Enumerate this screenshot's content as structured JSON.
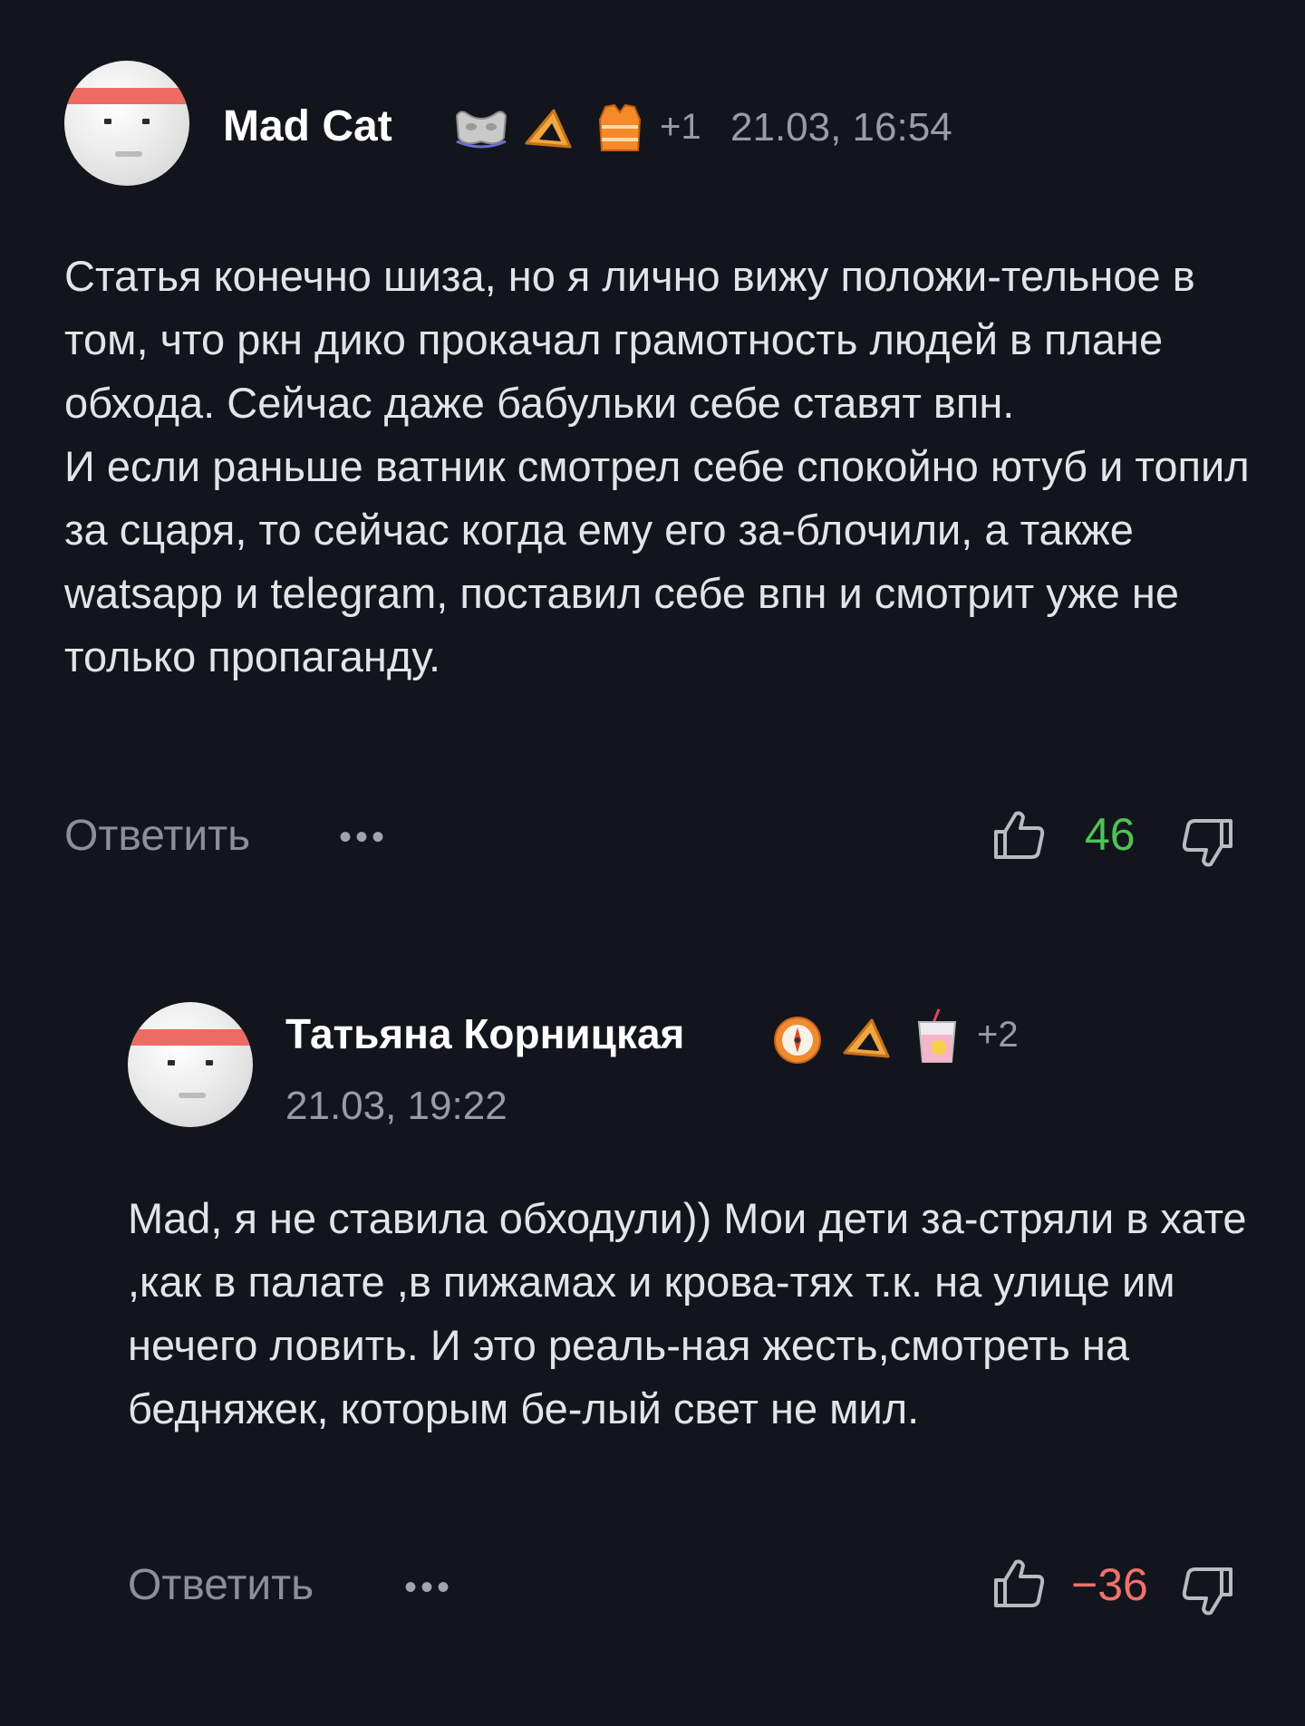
{
  "colors": {
    "background": "#13151c",
    "positive": "#4fc356",
    "negative": "#f0716c",
    "muted": "#8d8f96"
  },
  "comments": [
    {
      "author": "Mad Cat",
      "badges": [
        "mask-badge-icon",
        "triangle-pastry-badge-icon",
        "life-vest-badge-icon"
      ],
      "badge_extra": "+1",
      "timestamp": "21.03, 16:54",
      "paragraphs": [
        "Статья конечно шиза, но я лично вижу положи-тельное в том, что ркн дико прокачал грамотность людей в плане обхода. Сейчас даже бабульки себе ставят впн.",
        "И если раньше ватник смотрел себе спокойно ютуб и топил за сцаря, то сейчас когда ему его за-блочили, а также watsapp и telegram, поставил себе впн и смотрит уже не только пропаганду."
      ],
      "reply_label": "Ответить",
      "more_label": "•••",
      "score": "46",
      "score_sign": "positive"
    },
    {
      "author": "Татьяна Корницкая",
      "badges": [
        "compass-badge-icon",
        "triangle-pastry-badge-icon",
        "drink-glass-badge-icon"
      ],
      "badge_extra": "+2",
      "timestamp": "21.03, 19:22",
      "paragraphs": [
        "Mad, я не ставила обходули)) Мои дети за-стряли в хате ,как в палате ,в пижамах и крова-тях т.к. на улице им нечего ловить. И это реаль-ная жесть,смотреть на бедняжек, которым бе-лый свет не мил."
      ],
      "reply_label": "Ответить",
      "more_label": "•••",
      "score": "−36",
      "score_sign": "negative"
    }
  ]
}
